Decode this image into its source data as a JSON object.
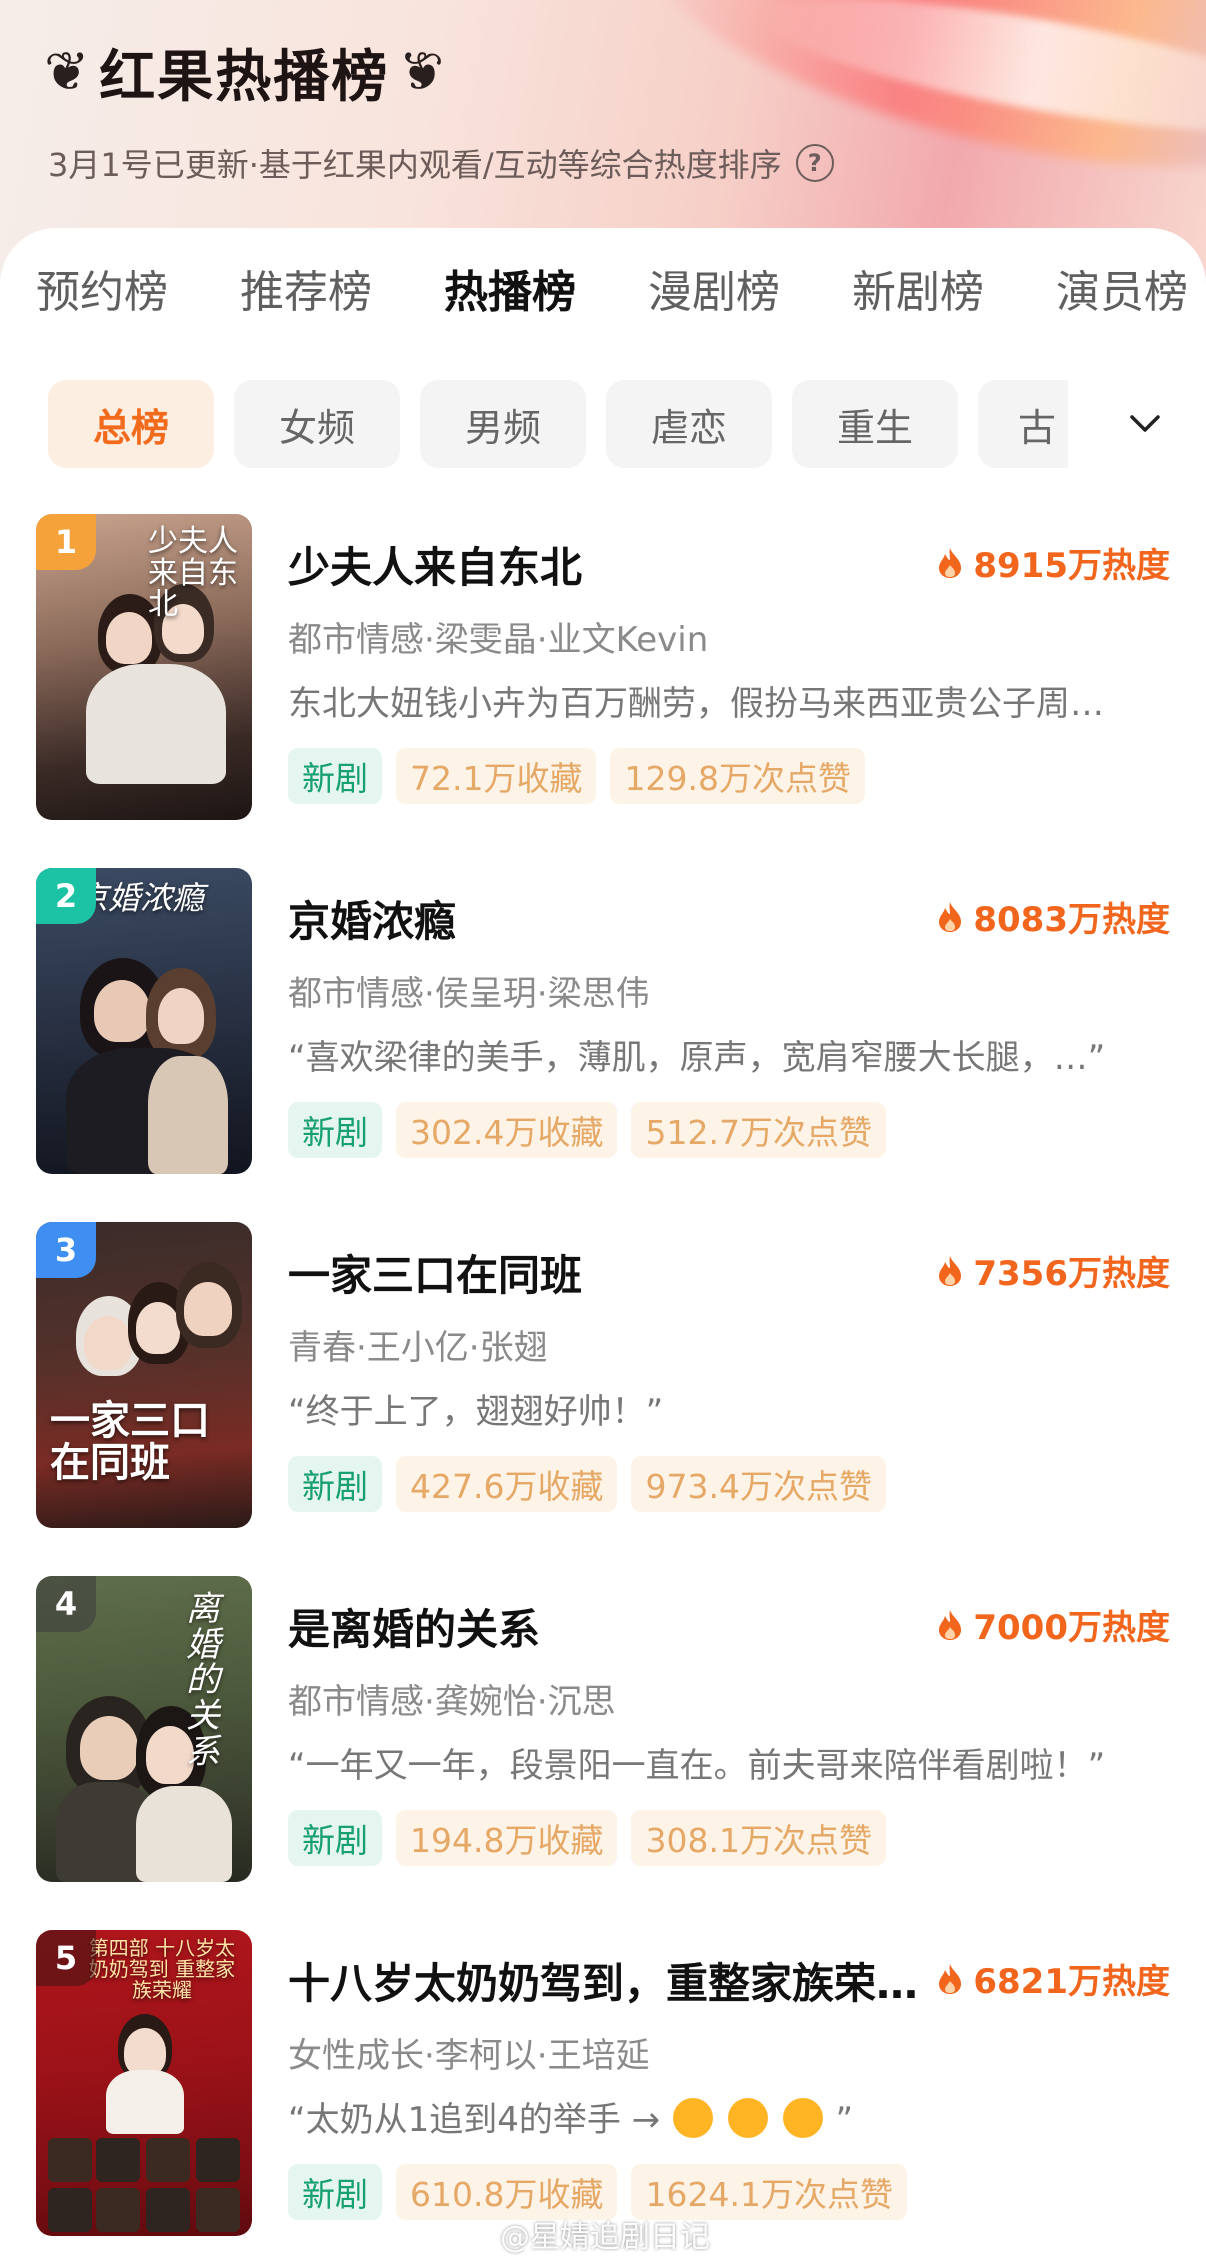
{
  "header": {
    "title": "红果热播榜",
    "subtitle": "3月1号已更新·基于红果内观看/互动等综合热度排序",
    "help_icon": "?"
  },
  "tabs": [
    "预约榜",
    "推荐榜",
    "热播榜",
    "漫剧榜",
    "新剧榜",
    "演员榜"
  ],
  "active_tab": "热播榜",
  "filters": [
    "总榜",
    "女频",
    "男频",
    "虐恋",
    "重生",
    "古"
  ],
  "active_filter": "总榜",
  "colors": {
    "accent": "#f26a1b",
    "heat": "#f2651d",
    "new_tag": "#19a070",
    "stat_tag": "#e5a867"
  },
  "dramas": [
    {
      "rank": "1",
      "title": "少夫人来自东北",
      "heat": "8915万热度",
      "meta": "都市情感·梁雯晶·业文Kevin",
      "desc": "东北大妞钱小卉为百万酬劳，假扮马来西亚贵公子周…",
      "tags": [
        "新剧",
        "72.1万收藏",
        "129.8万次点赞"
      ],
      "poster_text": "少夫人来自东北"
    },
    {
      "rank": "2",
      "title": "京婚浓瘾",
      "heat": "8083万热度",
      "meta": "都市情感·侯呈玥·梁思伟",
      "desc": "“喜欢梁律的美手，薄肌，原声，宽肩窄腰大长腿，…”",
      "tags": [
        "新剧",
        "302.4万收藏",
        "512.7万次点赞"
      ],
      "poster_text": "京婚浓瘾"
    },
    {
      "rank": "3",
      "title": "一家三口在同班",
      "heat": "7356万热度",
      "meta": "青春·王小亿·张翅",
      "desc": "“终于上了，翅翅好帅！”",
      "tags": [
        "新剧",
        "427.6万收藏",
        "973.4万次点赞"
      ],
      "poster_text": "一家三口在同班"
    },
    {
      "rank": "4",
      "title": "是离婚的关系",
      "heat": "7000万热度",
      "meta": "都市情感·龚婉怡·沉思",
      "desc": "“一年又一年，段景阳一直在。前夫哥来陪伴看剧啦！”",
      "tags": [
        "新剧",
        "194.8万收藏",
        "308.1万次点赞"
      ],
      "poster_text": "离婚的关系"
    },
    {
      "rank": "5",
      "title": "十八岁太奶奶驾到，重整家族荣…",
      "heat": "6821万热度",
      "meta": "女性成长·李柯以·王培延",
      "desc": "“太奶从1追到4的举手 →",
      "desc_end": "”",
      "tags": [
        "新剧",
        "610.8万收藏",
        "1624.1万次点赞"
      ],
      "poster_text": "第四部 十八岁太奶奶驾到 重整家族荣耀"
    }
  ],
  "watermark": "@星婧追剧日记"
}
